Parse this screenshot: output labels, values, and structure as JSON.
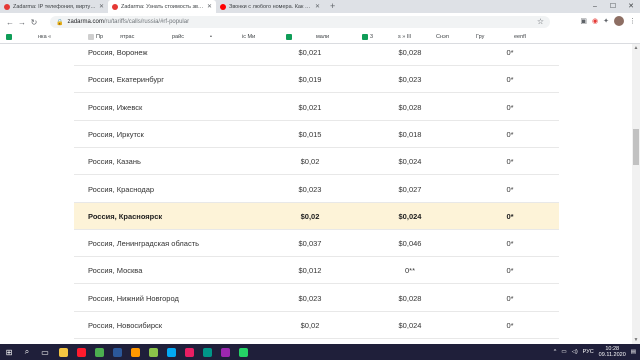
{
  "browser": {
    "tabs": [
      {
        "title": "Zadarma: IP телефония, виртуальны",
        "favicon_color": "#e53935",
        "active": false
      },
      {
        "title": "Zadarma: Узнать стоимость звонк",
        "favicon_color": "#e53935",
        "active": true
      },
      {
        "title": "Звонки с любого номера. Как изм",
        "favicon_color": "#ff0000",
        "active": false
      }
    ],
    "new_tab": "+",
    "window_controls": [
      "–",
      "☐",
      "✕"
    ],
    "url_host": "zadarma.com",
    "url_path": "/ru/tariffs/calls/russia/#rf-popular",
    "bookmarks": [
      {
        "label": "",
        "color": "#0f9d58"
      },
      {
        "label": "нка «",
        "color": ""
      },
      {
        "label": "Пр",
        "color": "#cfcfcf"
      },
      {
        "label": "ятрас",
        "color": ""
      },
      {
        "label": "райс",
        "color": ""
      },
      {
        "label": "•",
        "color": ""
      },
      {
        "label": "іс Ми",
        "color": ""
      },
      {
        "label": "",
        "color": "#0f9d58"
      },
      {
        "label": "мали",
        "color": ""
      },
      {
        "label": "3",
        "color": "#0f9d58"
      },
      {
        "label": "s » Ill",
        "color": ""
      },
      {
        "label": "Снэп",
        "color": ""
      },
      {
        "label": "Гру",
        "color": ""
      },
      {
        "label": "eenfl",
        "color": ""
      }
    ]
  },
  "rates_table": {
    "rows": [
      {
        "city": "Россия, Воронеж",
        "price_a": "$0,021",
        "price_b": "$0,028",
        "price_c": "0*",
        "highlight": false
      },
      {
        "city": "Россия, Екатеринбург",
        "price_a": "$0,019",
        "price_b": "$0,023",
        "price_c": "0*",
        "highlight": false
      },
      {
        "city": "Россия, Ижевск",
        "price_a": "$0,021",
        "price_b": "$0,028",
        "price_c": "0*",
        "highlight": false
      },
      {
        "city": "Россия, Иркутск",
        "price_a": "$0,015",
        "price_b": "$0,018",
        "price_c": "0*",
        "highlight": false
      },
      {
        "city": "Россия, Казань",
        "price_a": "$0,02",
        "price_b": "$0,024",
        "price_c": "0*",
        "highlight": false
      },
      {
        "city": "Россия, Краснодар",
        "price_a": "$0,023",
        "price_b": "$0,027",
        "price_c": "0*",
        "highlight": false
      },
      {
        "city": "Россия, Красноярск",
        "price_a": "$0,02",
        "price_b": "$0,024",
        "price_c": "0*",
        "highlight": true
      },
      {
        "city": "Россия, Ленинградская область",
        "price_a": "$0,037",
        "price_b": "$0,046",
        "price_c": "0*",
        "highlight": false
      },
      {
        "city": "Россия, Москва",
        "price_a": "$0,012",
        "price_b": "0**",
        "price_c": "0*",
        "highlight": false
      },
      {
        "city": "Россия, Нижний Новгород",
        "price_a": "$0,023",
        "price_b": "$0,028",
        "price_c": "0*",
        "highlight": false
      },
      {
        "city": "Россия, Новосибирск",
        "price_a": "$0,02",
        "price_b": "$0,024",
        "price_c": "0*",
        "highlight": false
      }
    ]
  },
  "taskbar": {
    "items": [
      {
        "name": "start",
        "color": "#ffffff"
      },
      {
        "name": "search",
        "color": "#ffffff"
      },
      {
        "name": "task-view",
        "color": "#ffffff"
      },
      {
        "name": "file-explorer",
        "color": "#f4c542"
      },
      {
        "name": "opera",
        "color": "#ff1b2d"
      },
      {
        "name": "chrome",
        "color": "#4caf50"
      },
      {
        "name": "word",
        "color": "#2b579a"
      },
      {
        "name": "app-orange",
        "color": "#ff9800"
      },
      {
        "name": "app-green",
        "color": "#8bc34a"
      },
      {
        "name": "app-blue",
        "color": "#03a9f4"
      },
      {
        "name": "app-red",
        "color": "#e91e63"
      },
      {
        "name": "app-teal",
        "color": "#009688"
      },
      {
        "name": "app-purple",
        "color": "#9c27b0"
      },
      {
        "name": "whatsapp",
        "color": "#25d366"
      }
    ],
    "lang": "РУС",
    "time": "10:28",
    "date": "09.11.2020"
  }
}
